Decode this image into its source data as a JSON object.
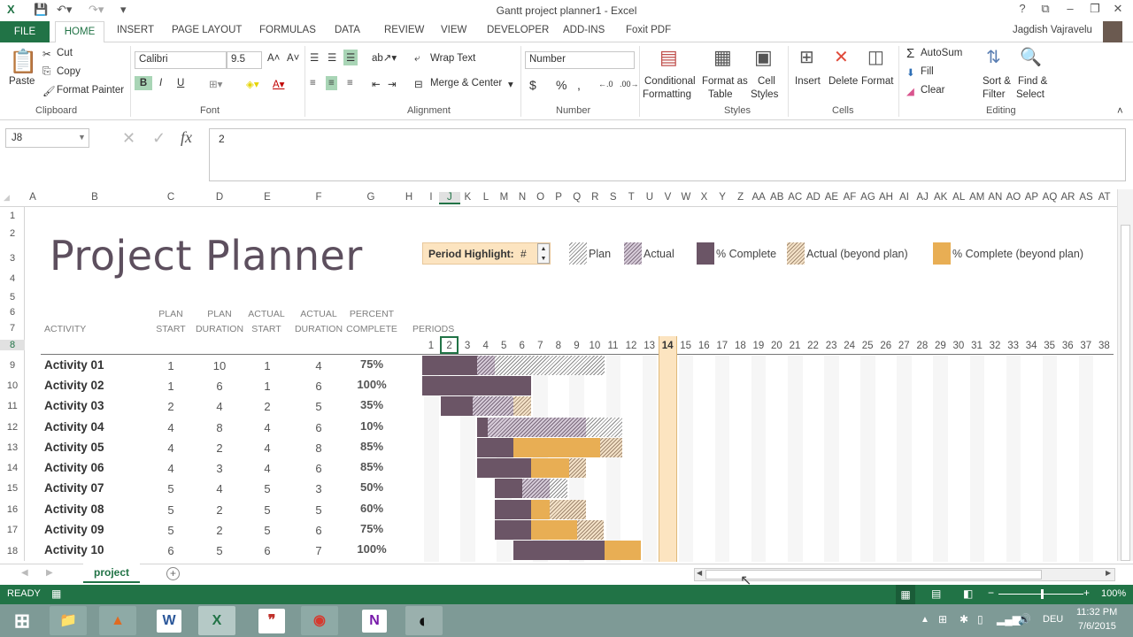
{
  "window": {
    "title": "Gantt project planner1 - Excel",
    "user": "Jagdish Vajravelu",
    "help_icon": "question-icon",
    "controls": [
      "?",
      "⧉",
      "–",
      "❐",
      "✕"
    ]
  },
  "tabs": [
    "FILE",
    "HOME",
    "INSERT",
    "PAGE LAYOUT",
    "FORMULAS",
    "DATA",
    "REVIEW",
    "VIEW",
    "DEVELOPER",
    "ADD-INS",
    "Foxit PDF"
  ],
  "active_tab": "HOME",
  "ribbon": {
    "clipboard": {
      "label": "Clipboard",
      "paste": "Paste",
      "cut": "Cut",
      "copy": "Copy",
      "format_painter": "Format Painter"
    },
    "font": {
      "label": "Font",
      "name": "Calibri",
      "size": "9.5",
      "bold": "B",
      "italic": "I",
      "underline": "U"
    },
    "alignment": {
      "label": "Alignment",
      "wrap_text": "Wrap Text",
      "merge_center": "Merge & Center"
    },
    "number": {
      "label": "Number",
      "format": "Number",
      "currency": "$",
      "percent": "%",
      "comma": ","
    },
    "styles": {
      "label": "Styles",
      "conditional": [
        "Conditional",
        "Formatting"
      ],
      "format_table": [
        "Format as",
        "Table"
      ],
      "cell_styles": [
        "Cell",
        "Styles"
      ]
    },
    "cells": {
      "label": "Cells",
      "insert": "Insert",
      "delete": "Delete",
      "format": "Format"
    },
    "editing": {
      "label": "Editing",
      "autosum": "AutoSum",
      "fill": "Fill",
      "clear": "Clear",
      "sort": [
        "Sort &",
        "Filter"
      ],
      "find": [
        "Find &",
        "Select"
      ]
    }
  },
  "formula_bar": {
    "name_box": "J8",
    "value": "2",
    "fx": "fx"
  },
  "columns": [
    "A",
    "B",
    "C",
    "D",
    "E",
    "F",
    "G",
    "H",
    "I",
    "J",
    "K",
    "L",
    "M",
    "N",
    "O",
    "P",
    "Q",
    "R",
    "S",
    "T",
    "U",
    "V",
    "W",
    "X",
    "Y",
    "Z",
    "AA",
    "AB",
    "AC",
    "AD",
    "AE",
    "AF",
    "AG",
    "AH",
    "AI",
    "AJ",
    "AK",
    "AL",
    "AM",
    "AN",
    "AO",
    "AP",
    "AQ",
    "AR",
    "AS",
    "AT"
  ],
  "rows": [
    "1",
    "2",
    "3",
    "4",
    "5",
    "6",
    "7",
    "8",
    "9",
    "10",
    "11",
    "12",
    "13",
    "14",
    "15",
    "16",
    "17",
    "18"
  ],
  "sheet": {
    "title": "Project Planner",
    "period_highlight_label": "Period Highlight:",
    "period_highlight_value": "#",
    "highlighted_period": 14,
    "legend": [
      {
        "label": "Plan",
        "style": "hatch-plan"
      },
      {
        "label": "Actual",
        "style": "hatch-actual"
      },
      {
        "label": "% Complete",
        "style": "solid-comp"
      },
      {
        "label": "Actual (beyond plan)",
        "style": "hatch-beyond"
      },
      {
        "label": "% Complete (beyond plan)",
        "style": "solid-beyond"
      }
    ],
    "headers": {
      "activity": "ACTIVITY",
      "plan_start": [
        "PLAN",
        "START"
      ],
      "plan_duration": [
        "PLAN",
        "DURATION"
      ],
      "actual_start": [
        "ACTUAL",
        "START"
      ],
      "actual_duration": [
        "ACTUAL",
        "DURATION"
      ],
      "percent_complete": [
        "PERCENT",
        "COMPLETE"
      ],
      "periods": "PERIODS"
    },
    "period_count": 38,
    "activities": [
      {
        "name": "Activity 01",
        "plan_start": 1,
        "plan_duration": 10,
        "actual_start": 1,
        "actual_duration": 4,
        "percent": "75%"
      },
      {
        "name": "Activity 02",
        "plan_start": 1,
        "plan_duration": 6,
        "actual_start": 1,
        "actual_duration": 6,
        "percent": "100%"
      },
      {
        "name": "Activity 03",
        "plan_start": 2,
        "plan_duration": 4,
        "actual_start": 2,
        "actual_duration": 5,
        "percent": "35%"
      },
      {
        "name": "Activity 04",
        "plan_start": 4,
        "plan_duration": 8,
        "actual_start": 4,
        "actual_duration": 6,
        "percent": "10%"
      },
      {
        "name": "Activity 05",
        "plan_start": 4,
        "plan_duration": 2,
        "actual_start": 4,
        "actual_duration": 8,
        "percent": "85%"
      },
      {
        "name": "Activity 06",
        "plan_start": 4,
        "plan_duration": 3,
        "actual_start": 4,
        "actual_duration": 6,
        "percent": "85%"
      },
      {
        "name": "Activity 07",
        "plan_start": 5,
        "plan_duration": 4,
        "actual_start": 5,
        "actual_duration": 3,
        "percent": "50%"
      },
      {
        "name": "Activity 08",
        "plan_start": 5,
        "plan_duration": 2,
        "actual_start": 5,
        "actual_duration": 5,
        "percent": "60%"
      },
      {
        "name": "Activity 09",
        "plan_start": 5,
        "plan_duration": 2,
        "actual_start": 5,
        "actual_duration": 6,
        "percent": "75%"
      },
      {
        "name": "Activity 10",
        "plan_start": 6,
        "plan_duration": 5,
        "actual_start": 6,
        "actual_duration": 7,
        "percent": "100%"
      }
    ]
  },
  "sheet_tabs": {
    "active": "project",
    "add": "+"
  },
  "status": {
    "ready": "READY",
    "zoom": "100%",
    "zoom_fraction": 0.5
  },
  "taskbar": {
    "apps": [
      "windows-start",
      "file-explorer",
      "matlab",
      "word",
      "excel",
      "quote-app",
      "chrome",
      "onenote",
      "obs"
    ],
    "lang": "DEU",
    "time": "11:32 PM",
    "date": "7/6/2015"
  },
  "colors": {
    "excel_green": "#217346",
    "complete": "#6b5566",
    "beyond": "#e8ae54",
    "highlight": "#fce4c0"
  }
}
